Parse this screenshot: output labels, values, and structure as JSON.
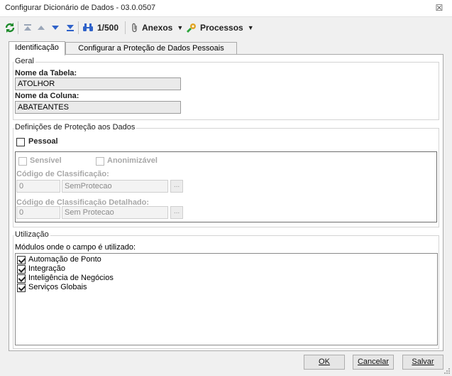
{
  "window": {
    "title": "Configurar Dicionário de Dados - 03.0.0507",
    "close_glyph": "☒"
  },
  "toolbar": {
    "record_counter": "1/500",
    "anexos_label": "Anexos",
    "processos_label": "Processos"
  },
  "tabs": [
    {
      "label": "Identificação",
      "active": true
    },
    {
      "label": "Configurar a Proteção de Dados Pessoais",
      "active": false
    }
  ],
  "geral": {
    "legend": "Geral",
    "tabela_label": "Nome da Tabela:",
    "tabela_value": "ATOLHOR",
    "coluna_label": "Nome da Coluna:",
    "coluna_value": "ABATEANTES"
  },
  "protecao": {
    "legend": "Definições de Proteção aos Dados",
    "pessoal_label": "Pessoal",
    "pessoal_checked": false,
    "sensivel_label": "Sensível",
    "anonimizavel_label": "Anonimizável",
    "classificacao_label": "Código de Classificação:",
    "classificacao_code": "0",
    "classificacao_desc": "SemProtecao",
    "classificacao_det_label": "Código de Classificação Detalhado:",
    "classificacao_det_code": "0",
    "classificacao_det_desc": "Sem Protecao",
    "lookup_label": "..."
  },
  "utilizacao": {
    "legend": "Utilização",
    "modules_label": "Módulos onde o campo é utilizado:",
    "modules": [
      {
        "label": "Automação de Ponto",
        "checked": true
      },
      {
        "label": "Integração",
        "checked": true
      },
      {
        "label": "Inteligência de Negócios",
        "checked": true
      },
      {
        "label": "Serviços Globais",
        "checked": true
      }
    ]
  },
  "buttons": {
    "ok_label": "OK",
    "cancel_label": "Cancelar",
    "save_label": "Salvar"
  }
}
